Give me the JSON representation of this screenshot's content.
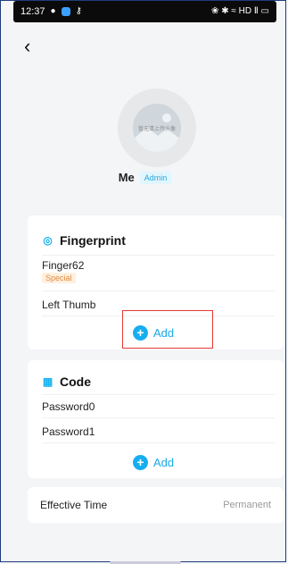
{
  "status_bar": {
    "time": "12:37",
    "right_text": "❀ ✱ ≈ HD Ⅱ ▭"
  },
  "user": {
    "avatar_caption": "暂无清上传头像",
    "name": "Me",
    "role": "Admin"
  },
  "fingerprint": {
    "title": "Fingerprint",
    "items": [
      {
        "label": "Finger62",
        "tag": "Special"
      },
      {
        "label": "Left Thumb"
      }
    ],
    "add_label": "Add"
  },
  "code": {
    "title": "Code",
    "items": [
      {
        "label": "Password0"
      },
      {
        "label": "Password1"
      }
    ],
    "add_label": "Add"
  },
  "effective_time": {
    "label": "Effective Time",
    "value": "Permanent"
  },
  "colors": {
    "accent": "#17aef0",
    "highlight": "#e53935",
    "special_tag": "#e08a3c"
  }
}
